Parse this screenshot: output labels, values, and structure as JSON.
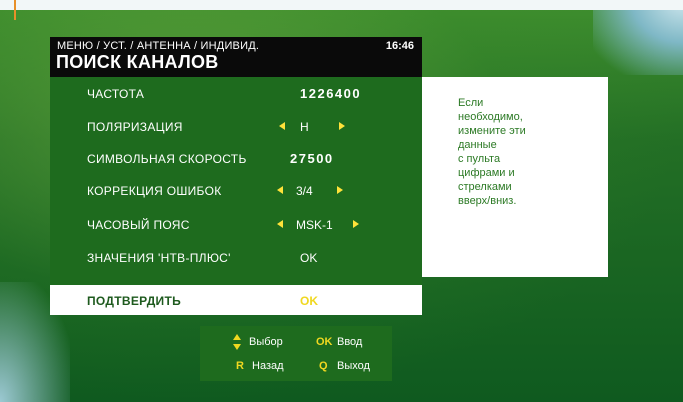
{
  "header": {
    "breadcrumb": "МЕНЮ / УСТ. / АНТЕННА / ИНДИВИД.",
    "time": "16:46",
    "title": "ПОИСК КАНАЛОВ"
  },
  "menu": {
    "frequency": {
      "label": "ЧАСТОТА",
      "value": "1226400"
    },
    "polarization": {
      "label": "ПОЛЯРИЗАЦИЯ",
      "value": "H"
    },
    "symbol_rate": {
      "label": "СИМВОЛЬНАЯ СКОРОСТЬ",
      "value": "27500"
    },
    "fec": {
      "label": "КОРРЕКЦИЯ ОШИБОК",
      "value": "3/4"
    },
    "timezone": {
      "label": "ЧАСОВЫЙ ПОЯС",
      "value": "MSK-1"
    },
    "ntv_values": {
      "label": "ЗНАЧЕНИЯ 'НТВ-ПЛЮС'",
      "value": "OK"
    },
    "confirm": {
      "label": "ПОДТВЕРДИТЬ",
      "value": "OK"
    }
  },
  "help": {
    "text": "Если\nнеобходимо,\nизмените эти\nданные\nс пульта\nцифрами и\nстрелками\nвверх/вниз."
  },
  "legend": {
    "select_label": "Выбор",
    "ok_key": "OK",
    "enter_label": "Ввод",
    "r_key": "R",
    "back_label": "Назад",
    "q_key": "Q",
    "exit_label": "Выход"
  },
  "colors": {
    "osd_green": "#1e6b1e",
    "accent_yellow": "#f0d820",
    "help_text_green": "#2c7a25"
  },
  "icons": [
    "left-arrow-icon",
    "right-arrow-icon",
    "up-down-arrow-icon"
  ]
}
